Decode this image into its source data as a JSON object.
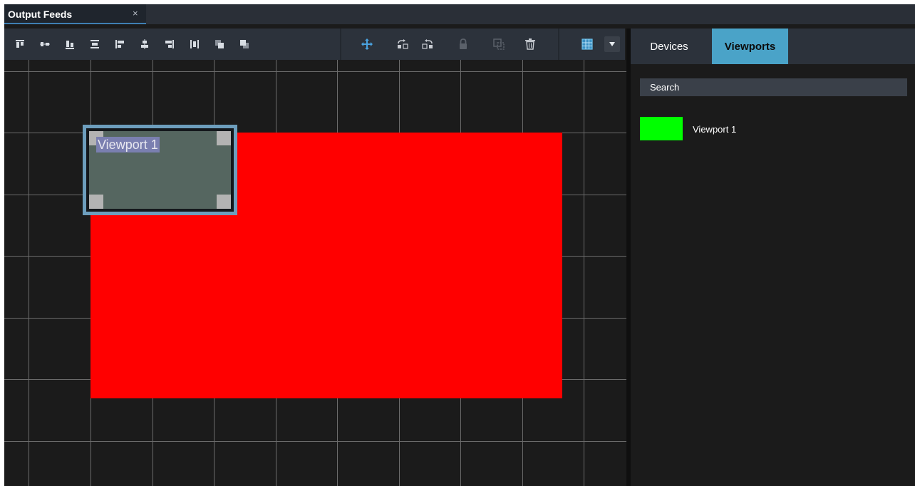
{
  "tab": {
    "title": "Output Feeds",
    "close": "×"
  },
  "toolbar": {
    "align_icons": [
      "align-top-icon",
      "align-center-vertical-icon",
      "align-bottom-icon",
      "align-middle-icon",
      "align-left-icon",
      "align-center-horizontal-icon",
      "align-right-icon",
      "distribute-icon",
      "bring-forward-icon",
      "send-backward-icon"
    ],
    "action_icons": [
      "move-icon",
      "rotate-left-icon",
      "rotate-right-icon",
      "lock-icon",
      "duplicate-icon",
      "trash-icon"
    ],
    "grid_icon": "grid-icon",
    "dropdown_icon": "chevron-down-icon"
  },
  "canvas": {
    "output_color": "#ff0000",
    "viewport": {
      "label": "Viewport 1"
    }
  },
  "side": {
    "tabs": [
      {
        "label": "Devices"
      },
      {
        "label": "Viewports"
      }
    ],
    "search": {
      "placeholder": "Search"
    },
    "items": [
      {
        "name": "Viewport 1",
        "color": "#00ff00"
      }
    ]
  },
  "colors": {
    "accent": "#4aa3c8",
    "selection": "#6d9ebd",
    "move_icon": "#4aa3e0"
  }
}
